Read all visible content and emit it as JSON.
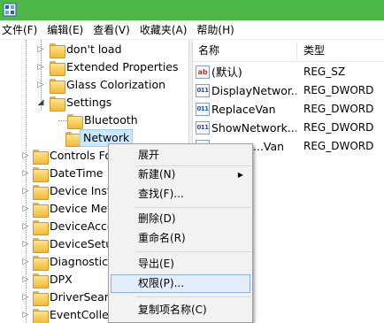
{
  "window": {
    "titlebar_color": "#4db848"
  },
  "menubar": {
    "items": [
      "文件(F)",
      "编辑(E)",
      "查看(V)",
      "收藏夹(A)",
      "帮助(H)"
    ]
  },
  "tree": {
    "items": [
      {
        "label": "don't load"
      },
      {
        "label": "Extended Properties"
      },
      {
        "label": "Glass Colorization"
      },
      {
        "label": "Settings"
      },
      {
        "label": "Bluetooth"
      },
      {
        "label": "Network"
      },
      {
        "label": "Controls Fo"
      },
      {
        "label": "DateTime"
      },
      {
        "label": "Device Insta"
      },
      {
        "label": "Device Met"
      },
      {
        "label": "DeviceAcce"
      },
      {
        "label": "DeviceSetu"
      },
      {
        "label": "Diagnostics"
      },
      {
        "label": "DPX"
      },
      {
        "label": "DriverSearc"
      },
      {
        "label": "EventCollec"
      }
    ]
  },
  "list": {
    "columns": [
      "名称",
      "类型"
    ],
    "rows": [
      {
        "name": "(默认)",
        "type": "REG_SZ",
        "icon": "string-value-icon"
      },
      {
        "name": "DisplayNetwor...",
        "type": "REG_DWORD",
        "icon": "dword-value-icon"
      },
      {
        "name": "ReplaceVan",
        "type": "REG_DWORD",
        "icon": "dword-value-icon"
      },
      {
        "name": "ShowNetwork...",
        "type": "REG_DWORD",
        "icon": "dword-value-icon"
      },
      {
        "name": "...Van",
        "type": "REG_DWORD",
        "icon": "dword-value-icon"
      }
    ]
  },
  "context_menu": {
    "items": [
      "展开",
      "新建(N)",
      "查找(F)...",
      "删除(D)",
      "重命名(R)",
      "导出(E)",
      "权限(P)...",
      "复制项名称(C)"
    ],
    "highlighted": "权限(P)..."
  }
}
